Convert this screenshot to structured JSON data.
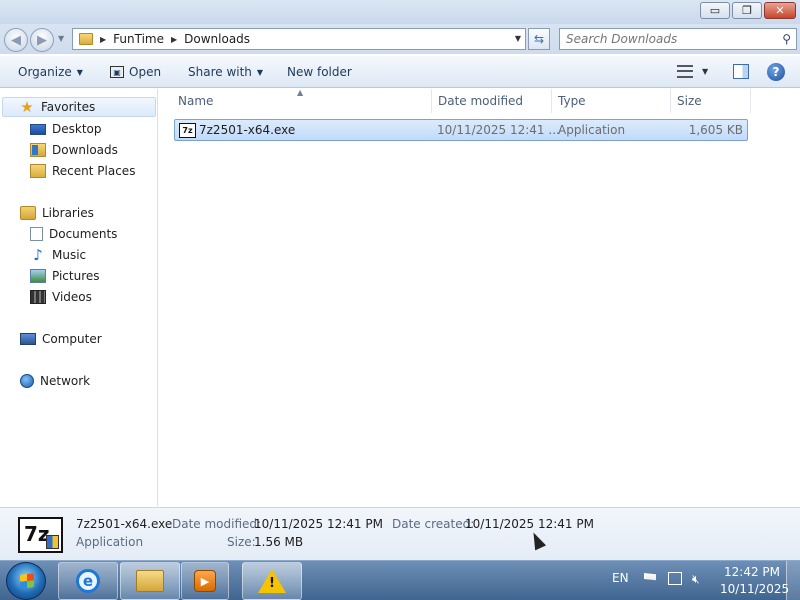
{
  "window": {
    "controls": {
      "minimize": "▭",
      "maximize": "❐",
      "close": "✕"
    }
  },
  "navigation": {
    "back": "◀",
    "forward": "▶",
    "breadcrumb": [
      "FunTime",
      "Downloads"
    ],
    "search_placeholder": "Search Downloads"
  },
  "toolbar": {
    "organize": "Organize",
    "open": "Open",
    "share_with": "Share with",
    "new_folder": "New folder",
    "help": "?"
  },
  "sidebar": {
    "favorites": {
      "header": "Favorites",
      "items": [
        "Desktop",
        "Downloads",
        "Recent Places"
      ]
    },
    "libraries": {
      "header": "Libraries",
      "items": [
        "Documents",
        "Music",
        "Pictures",
        "Videos"
      ]
    },
    "computer": "Computer",
    "network": "Network"
  },
  "filelist": {
    "columns": [
      "Name",
      "Date modified",
      "Type",
      "Size"
    ],
    "rows": [
      {
        "name": "7z2501-x64.exe",
        "date_modified": "10/11/2025 12:41 ...",
        "type": "Application",
        "size": "1,605 KB",
        "selected": true
      }
    ]
  },
  "details": {
    "file_name": "7z2501-x64.exe",
    "file_type": "Application",
    "date_modified_label": "Date modified:",
    "date_modified_value": "10/11/2025 12:41 PM",
    "date_created_label": "Date created:",
    "date_created_value": "10/11/2025 12:41 PM",
    "size_label": "Size:",
    "size_value": "1.56 MB",
    "icon_text": "7z"
  },
  "taskbar": {
    "language": "EN",
    "time": "12:42 PM",
    "date": "10/11/2025"
  }
}
